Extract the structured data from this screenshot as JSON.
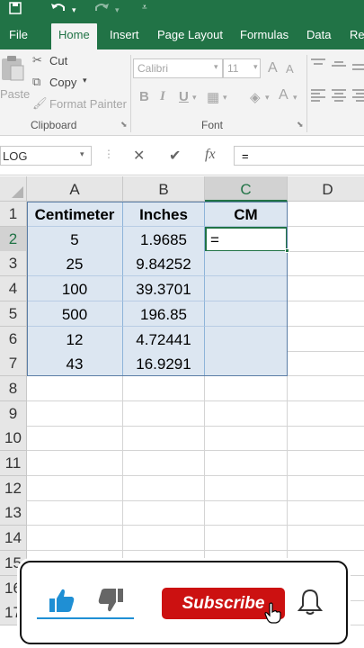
{
  "quick_access": {
    "save_icon": "save-icon",
    "undo_icon": "undo-icon",
    "redo_icon": "redo-icon",
    "customize_icon": "customize-icon"
  },
  "tabs": [
    {
      "label": "File",
      "active": false
    },
    {
      "label": "Home",
      "active": true
    },
    {
      "label": "Insert",
      "active": false
    },
    {
      "label": "Page Layout",
      "active": false
    },
    {
      "label": "Formulas",
      "active": false
    },
    {
      "label": "Data",
      "active": false
    },
    {
      "label": "Re",
      "active": false
    }
  ],
  "ribbon": {
    "clipboard": {
      "paste_label": "Paste",
      "cut_label": "Cut",
      "copy_label": "Copy",
      "format_painter_label": "Format Painter",
      "group_label": "Clipboard"
    },
    "font": {
      "font_name": "Calibri",
      "font_size": "11",
      "bold": "B",
      "italic": "I",
      "underline": "U",
      "group_label": "Font",
      "increase_size": "A",
      "decrease_size": "A"
    }
  },
  "formula_bar": {
    "name_box": "LOG",
    "cancel": "✕",
    "enter": "✔",
    "fx": "fx",
    "content": "="
  },
  "sheet": {
    "columns": [
      "A",
      "B",
      "C",
      "D"
    ],
    "rows": [
      "1",
      "2",
      "3",
      "4",
      "5",
      "6",
      "7",
      "8",
      "9",
      "10",
      "11",
      "12",
      "13",
      "14",
      "15",
      "16",
      "17"
    ],
    "headers": [
      "Centimeter",
      "Inches",
      "CM"
    ],
    "data": [
      [
        "5",
        "1.9685",
        "="
      ],
      [
        "25",
        "9.84252",
        ""
      ],
      [
        "100",
        "39.3701",
        ""
      ],
      [
        "500",
        "196.85",
        ""
      ],
      [
        "12",
        "4.72441",
        ""
      ],
      [
        "43",
        "16.9291",
        ""
      ]
    ]
  },
  "overlay": {
    "subscribe_label": "Subscribe",
    "like_icon": "thumbs-up-icon",
    "dislike_icon": "thumbs-down-icon",
    "bell_icon": "bell-icon"
  },
  "colors": {
    "excel_green": "#217346",
    "table_fill": "#dce6f1",
    "subscribe_red": "#cc1111"
  }
}
